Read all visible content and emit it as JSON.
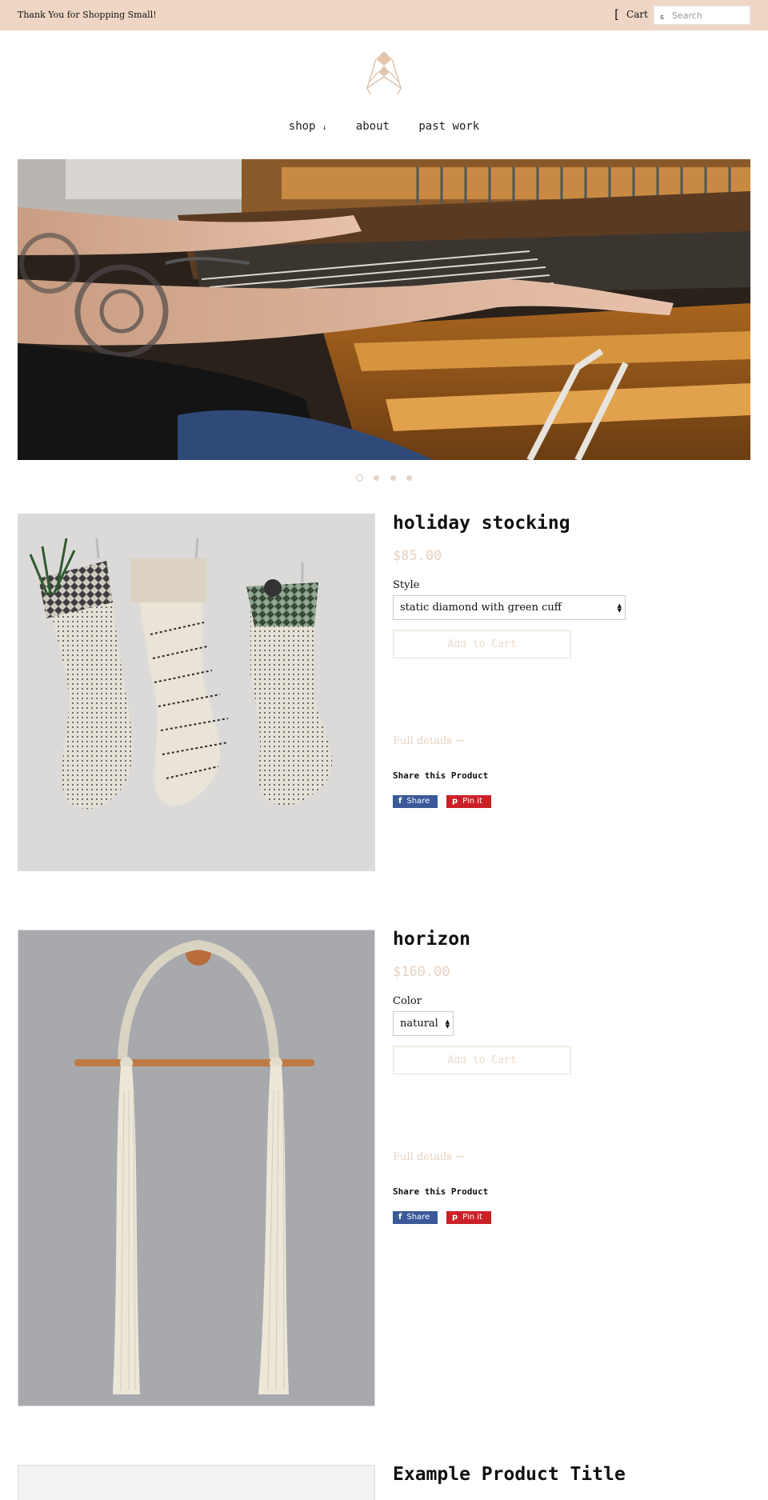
{
  "topbar": {
    "message": "Thank You for Shopping Small!",
    "cart_icon": "[",
    "cart_label": "Cart",
    "search_icon": "s",
    "search_placeholder": "Search"
  },
  "logo": {
    "icon": "diamond-logo-icon"
  },
  "nav": {
    "items": [
      {
        "label": "shop",
        "caret": "↓"
      },
      {
        "label": "about"
      },
      {
        "label": "past work"
      }
    ]
  },
  "slideshow": {
    "slide_count": 4,
    "active_index": 0
  },
  "products": [
    {
      "title": "holiday stocking",
      "price": "$85.00",
      "option_label": "Style",
      "option_value": "static diamond with green cuff",
      "add_to_cart": "Add to Cart",
      "full_details": "Full details →",
      "share_title": "Share this Product",
      "share_facebook": "Share",
      "share_pinterest": "Pin it",
      "facebook_icon": "f",
      "pinterest_icon": "p"
    },
    {
      "title": "horizon",
      "price": "$160.00",
      "option_label": "Color",
      "option_value": "natural",
      "add_to_cart": "Add to Cart",
      "full_details": "Full details →",
      "share_title": "Share this Product",
      "share_facebook": "Share",
      "share_pinterest": "Pin it",
      "facebook_icon": "f",
      "pinterest_icon": "p"
    },
    {
      "title": "Example Product Title"
    }
  ],
  "colors": {
    "announcement_bg": "#efd6c4",
    "accent": "#e7d2c2",
    "facebook": "#3b5998",
    "pinterest": "#cb2027"
  }
}
